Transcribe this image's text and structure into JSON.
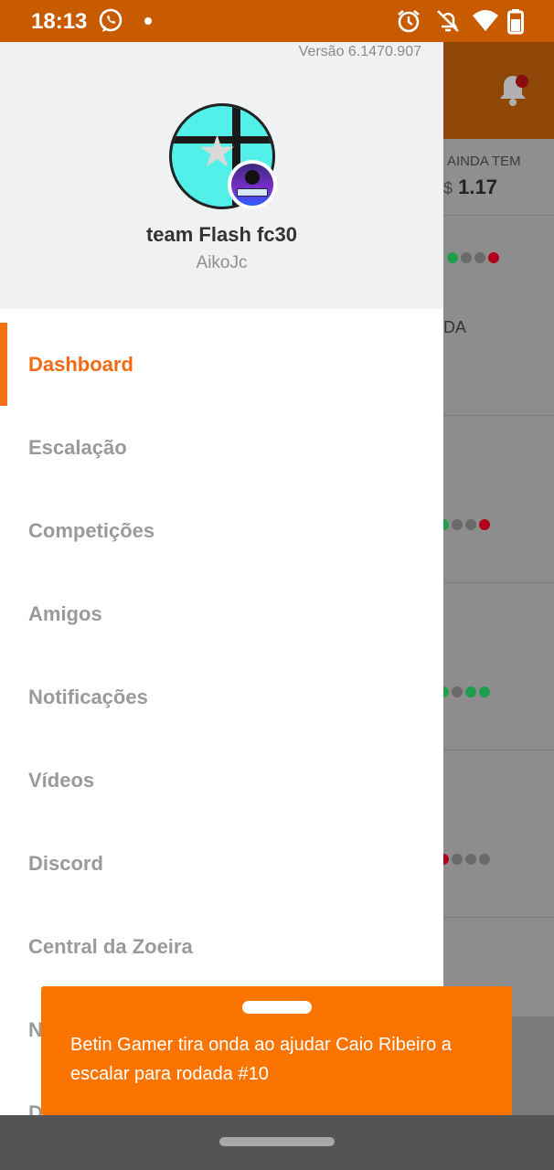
{
  "status_bar": {
    "time": "18:13",
    "icons": [
      "whatsapp-icon",
      "notification-dot-icon",
      "alarm-icon",
      "notifications-off-icon",
      "wifi-icon",
      "battery-icon"
    ]
  },
  "drawer": {
    "version": "Versão 6.1470.907",
    "team_name": "team Flash fc30",
    "user_name": "AikoJc",
    "menu_items": [
      {
        "label": "Dashboard",
        "active": true
      },
      {
        "label": "Escalação"
      },
      {
        "label": "Competições"
      },
      {
        "label": "Amigos"
      },
      {
        "label": "Notificações"
      },
      {
        "label": "Vídeos"
      },
      {
        "label": "Discord"
      },
      {
        "label": "Central da Zoeira"
      },
      {
        "label": "N"
      },
      {
        "label": "D"
      }
    ]
  },
  "background": {
    "stat_label": "AINDA TEM",
    "stat_currency": "$",
    "stat_value": "1.17",
    "row_text": "DA"
  },
  "toast": {
    "message": "Betin Gamer tira onda ao ajudar Caio Ribeiro a escalar para rodada #10"
  },
  "colors": {
    "accent": "#f37012",
    "toast_bg": "#fc7400",
    "status_bar": "#c85a00",
    "dot_green": "#1e9e4a",
    "dot_gray": "#6a6a6a",
    "dot_red": "#b3001a"
  }
}
